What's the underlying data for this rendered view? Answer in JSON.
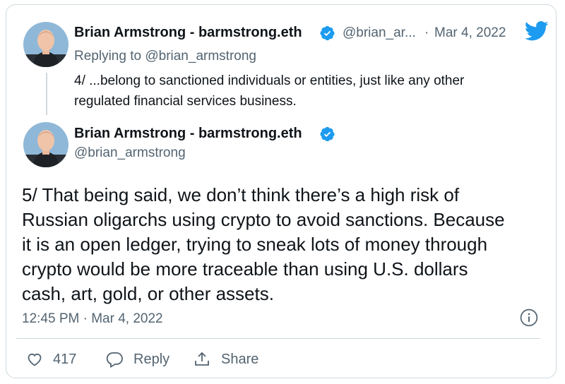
{
  "reply_tweet": {
    "author_name": "Brian Armstrong - barmstrong.eth",
    "handle_short": "@brian_ar...",
    "date_sep": "·",
    "date": "Mar 4, 2022",
    "replying_to": "Replying to @brian_armstrong",
    "text_line1": "4/ ...belong to sanctioned individuals or entities, just like any other",
    "text_line2": "regulated financial services business."
  },
  "main_tweet": {
    "author_name": "Brian Armstrong - barmstrong.eth",
    "handle": "@brian_armstrong",
    "lines": [
      "5/ That being said, we don’t think there’s a high risk of",
      "Russian oligarchs using crypto to avoid sanctions. Because",
      "it is an open ledger, trying to sneak lots of money through",
      "crypto would be more traceable than using U.S. dollars",
      "cash, art, gold, or other assets."
    ],
    "timestamp": "12:45 PM · Mar 4, 2022"
  },
  "actions": {
    "like_count": "417",
    "reply_label": "Reply",
    "share_label": "Share"
  },
  "colors": {
    "twitter_blue": "#1d9bf0",
    "verified_blue": "#1d9bf0",
    "muted_text": "#536471",
    "border": "#cfd9de"
  },
  "icons": [
    "twitter-bird-icon",
    "verified-badge-icon",
    "info-icon",
    "heart-icon",
    "reply-bubble-icon",
    "share-icon"
  ]
}
